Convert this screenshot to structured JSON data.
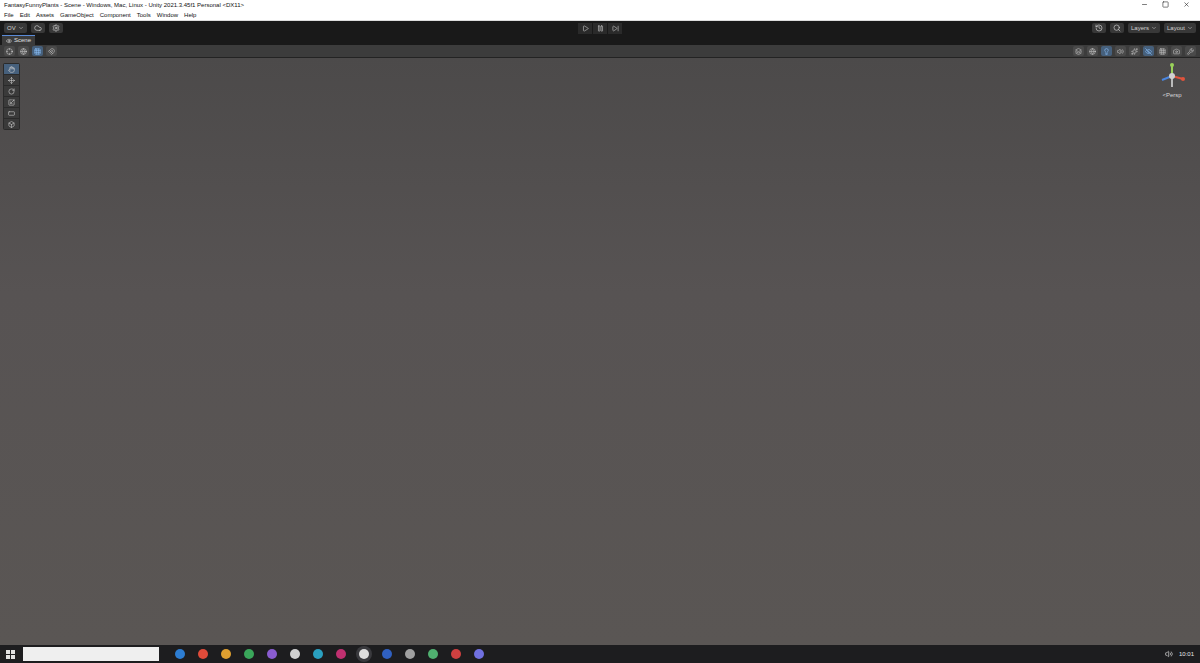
{
  "window": {
    "title": "FantasyFunnyPlants - Scene - Windows, Mac, Linux - Unity 2021.3.45f1 Personal <DX11>",
    "controls": [
      {
        "kind": "minimize"
      },
      {
        "kind": "maximize"
      },
      {
        "kind": "close"
      }
    ]
  },
  "menu": [
    "File",
    "Edit",
    "Assets",
    "GameObject",
    "Component",
    "Tools",
    "Window",
    "Help"
  ],
  "toolbar": {
    "account": "OV",
    "play_controls": [
      {
        "kind": "play",
        "selected": false
      },
      {
        "kind": "pause",
        "selected": false
      },
      {
        "kind": "step",
        "selected": false
      }
    ],
    "layers": "Layers",
    "layout": "Layout"
  },
  "tabs": [
    {
      "label": "Scene",
      "selected": true
    }
  ],
  "scene_toolbar": {
    "left": [
      {
        "kind": "pivot",
        "selected": false
      },
      {
        "kind": "global",
        "selected": false
      },
      {
        "kind": "grid",
        "selected": true
      },
      {
        "kind": "snap",
        "selected": false
      }
    ],
    "right": [
      {
        "kind": "layers",
        "selected": false
      },
      {
        "kind": "globe",
        "selected": false
      },
      {
        "kind": "light",
        "selected": true
      },
      {
        "kind": "audio",
        "selected": false
      },
      {
        "kind": "effects",
        "selected": false
      },
      {
        "kind": "hidden",
        "selected": true
      },
      {
        "kind": "grid",
        "selected": false
      },
      {
        "kind": "camera",
        "selected": false
      },
      {
        "kind": "gizmos",
        "selected": false
      }
    ]
  },
  "tools": [
    {
      "kind": "view",
      "selected": true
    },
    {
      "kind": "move",
      "selected": false
    },
    {
      "kind": "rotate",
      "selected": false
    },
    {
      "kind": "scale",
      "selected": false
    },
    {
      "kind": "rect",
      "selected": false
    },
    {
      "kind": "transform",
      "selected": false
    }
  ],
  "gizmo": {
    "label": "<Persp"
  },
  "taskbar": {
    "apps": [
      {
        "color": "#2d7dd2",
        "selected": false
      },
      {
        "color": "#e04b3a",
        "selected": false
      },
      {
        "color": "#e0a030",
        "selected": false
      },
      {
        "color": "#3aa65a",
        "selected": false
      },
      {
        "color": "#8a5cd0",
        "selected": false
      },
      {
        "color": "#d0d0d0",
        "selected": false
      },
      {
        "color": "#2aa0c0",
        "selected": false
      },
      {
        "color": "#c03070",
        "selected": false
      },
      {
        "color": "#dddddd",
        "selected": true
      },
      {
        "color": "#3060c0",
        "selected": false
      },
      {
        "color": "#a0a0a0",
        "selected": false
      },
      {
        "color": "#50b070",
        "selected": false
      },
      {
        "color": "#d04040",
        "selected": false
      },
      {
        "color": "#7070e0",
        "selected": false
      }
    ],
    "time": "10:01"
  }
}
